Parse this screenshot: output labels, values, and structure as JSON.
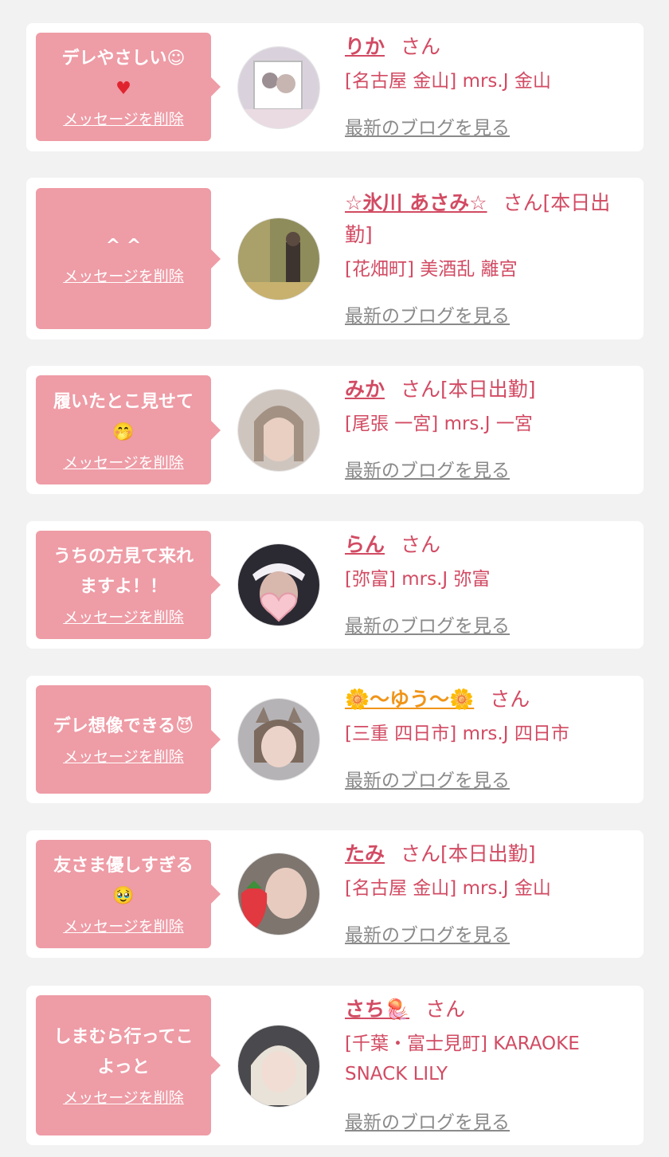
{
  "delete_label": "メッセージを削除",
  "blog_label": "最新のブログを見る",
  "san_label": "さん",
  "colors": {
    "background": "#f2f2f2",
    "card": "#ffffff",
    "bubble": "#ee9ca6",
    "accent": "#d24b63",
    "blog_link": "#8a8a8a"
  },
  "messages": [
    {
      "message_line1": "デレやさしい☺",
      "message_line2": "♥",
      "name": "りか",
      "status": "",
      "shop": "[名古屋 金山] mrs.J 金山",
      "avatar_icon": "photo-collage-icon"
    },
    {
      "message_line1": "^ ^",
      "message_line2": "",
      "name": "☆氷川 あさみ☆",
      "status": "[本日出勤]",
      "shop": "[花畑町] 美酒乱 離宮",
      "avatar_icon": "photo-autumn-icon"
    },
    {
      "message_line1": "履いたとこ見せて",
      "message_line2": "🤭",
      "name": "みか",
      "status": "[本日出勤]",
      "shop": "[尾張 一宮] mrs.J 一宮",
      "avatar_icon": "photo-selfie-icon"
    },
    {
      "message_line1": "うちの方見て来れ",
      "message_line2": "ますよ！！",
      "name": "らん",
      "status": "",
      "shop": "[弥富] mrs.J 弥富",
      "avatar_icon": "photo-heart-icon"
    },
    {
      "message_line1": "デレ想像できる😈",
      "message_line2": "",
      "name": "🌼〜ゆう〜🌼",
      "status": "",
      "shop": "[三重 四日市] mrs.J 四日市",
      "avatar_icon": "photo-cat-ears-icon"
    },
    {
      "message_line1": "友さま優しすぎる",
      "message_line2": "🥹",
      "name": "たみ",
      "status": "[本日出勤]",
      "shop": "[名古屋 金山] mrs.J 金山",
      "avatar_icon": "photo-strawberry-icon"
    },
    {
      "message_line1": "しまむら行ってこ",
      "message_line2": "よっと",
      "name": "さち🪼",
      "status": "",
      "shop": "[千葉・富士見町] KARAOKE SNACK LILY",
      "avatar_icon": "photo-blonde-icon"
    }
  ]
}
